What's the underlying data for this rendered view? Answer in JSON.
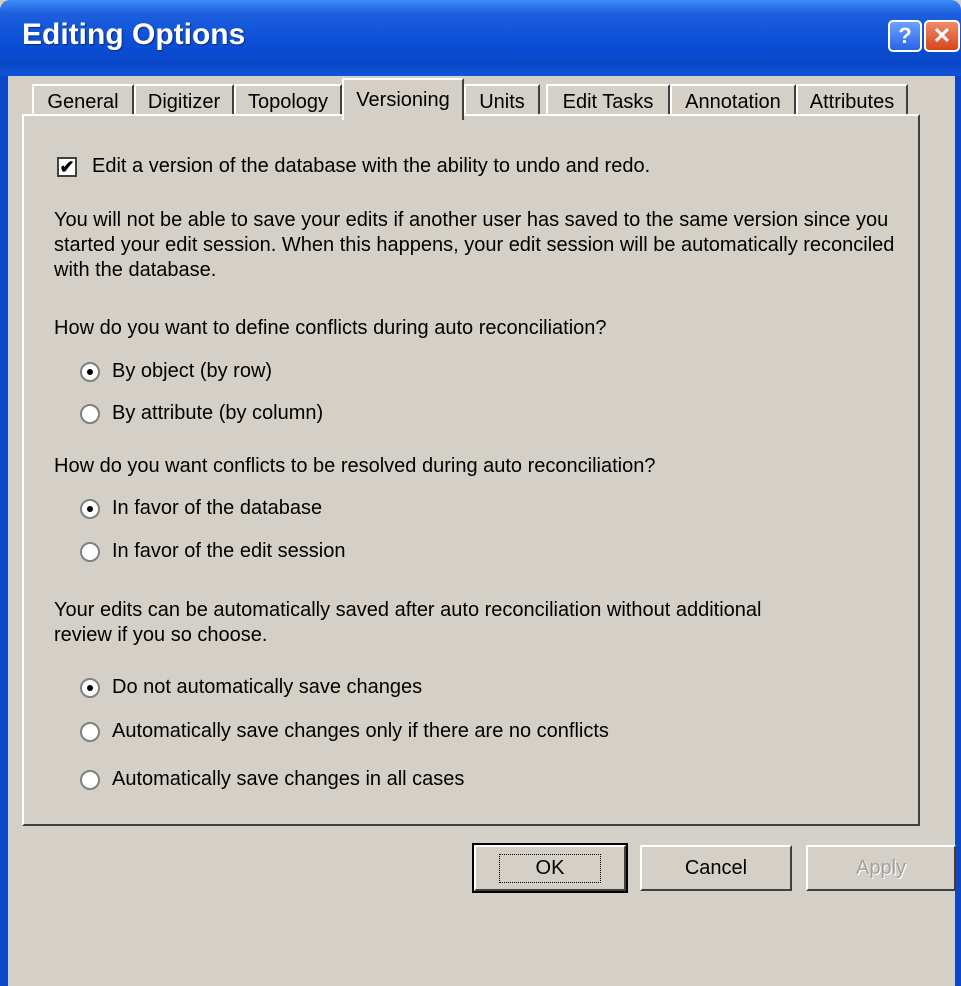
{
  "window": {
    "title": "Editing Options",
    "help_glyph": "?",
    "close_glyph": "✕"
  },
  "tabs": [
    {
      "label": "General"
    },
    {
      "label": "Digitizer"
    },
    {
      "label": "Topology"
    },
    {
      "label": "Versioning",
      "active": true
    },
    {
      "label": "Units"
    },
    {
      "label": "Edit Tasks"
    },
    {
      "label": "Annotation"
    },
    {
      "label": "Attributes"
    }
  ],
  "versioning": {
    "undo_redo_checkbox": {
      "checked": true,
      "check_glyph": "✔",
      "label": "Edit a version of the database with the ability to undo and redo."
    },
    "info_text": "You will not be able to save your edits if another user has saved to the same version since you started your edit session. When this happens, your edit session will be automatically reconciled with the database.",
    "conflict_definition": {
      "question": "How do you want to define conflicts during auto reconciliation?",
      "options": [
        {
          "label": "By object (by row)",
          "selected": true
        },
        {
          "label": "By attribute (by column)",
          "selected": false
        }
      ]
    },
    "conflict_resolution": {
      "question": "How do you want conflicts to be resolved during auto reconciliation?",
      "options": [
        {
          "label": "In favor of the database",
          "selected": true
        },
        {
          "label": "In favor of the edit session",
          "selected": false
        }
      ]
    },
    "autosave": {
      "question": "Your edits can be automatically saved after auto reconciliation without additional review if you so choose.",
      "options": [
        {
          "label": "Do not automatically save changes",
          "selected": true
        },
        {
          "label": "Automatically save changes only if there are no conflicts",
          "selected": false
        },
        {
          "label": "Automatically save changes in all cases",
          "selected": false
        }
      ]
    }
  },
  "buttons": {
    "ok": "OK",
    "cancel": "Cancel",
    "apply": "Apply"
  }
}
